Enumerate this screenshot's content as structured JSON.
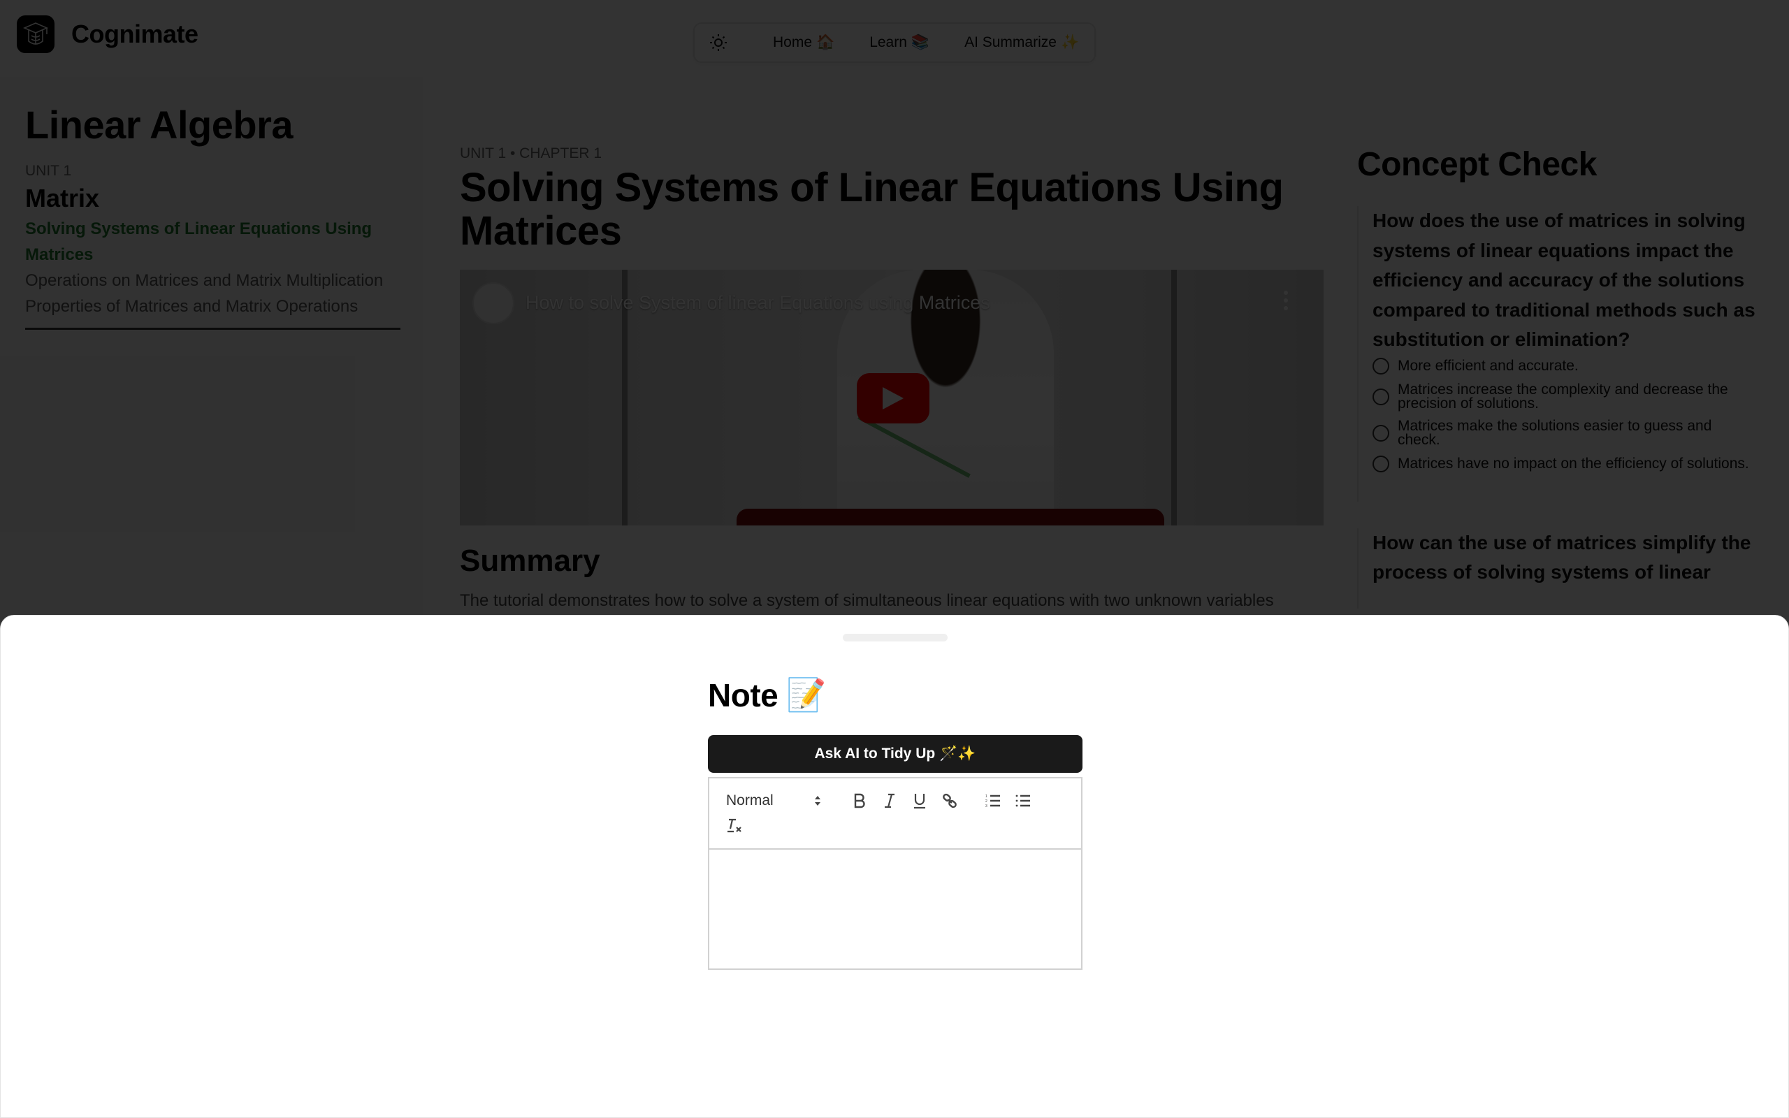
{
  "app": {
    "name": "Cognimate",
    "logo_icon": "graduation-cap-tree-icon"
  },
  "nav": {
    "theme_icon": "sun-icon",
    "items": [
      {
        "label": "Home",
        "emoji": "🏠"
      },
      {
        "label": "Learn",
        "emoji": "📚"
      },
      {
        "label": "AI Summarize",
        "emoji": "✨"
      }
    ]
  },
  "sidebar": {
    "course_title": "Linear Algebra",
    "unit_label": "UNIT 1",
    "unit_title": "Matrix",
    "chapters": [
      {
        "label": "Solving Systems of Linear Equations Using Matrices",
        "active": true
      },
      {
        "label": "Operations on Matrices and Matrix Multiplication",
        "active": false
      },
      {
        "label": "Properties of Matrices and Matrix Operations",
        "active": false
      }
    ],
    "active_color": "#1f7a2e"
  },
  "main": {
    "breadcrumb": "UNIT 1 • CHAPTER 1",
    "title": "Solving Systems of Linear Equations Using Matrices",
    "video": {
      "title": "How to solve System of linear Equations using Matrices",
      "play_icon": "youtube-play-icon",
      "menu_icon": "more-vertical-icon"
    },
    "summary_title": "Summary",
    "summary_text": "The tutorial demonstrates how to solve a system of simultaneous linear equations with two unknown variables"
  },
  "concept_check": {
    "title": "Concept Check",
    "questions": [
      {
        "question": "How does the use of matrices in solving systems of linear equations impact the efficiency and accuracy of the solutions compared to traditional methods such as substitution or elimination?",
        "options": [
          "More efficient and accurate.",
          "Matrices increase the complexity and decrease the precision of solutions.",
          "Matrices make the solutions easier to guess and check.",
          "Matrices have no impact on the efficiency of solutions."
        ]
      },
      {
        "question": "How can the use of matrices simplify the process of solving systems of linear",
        "options": []
      }
    ]
  },
  "note_drawer": {
    "title": "Note",
    "title_emoji": "📝",
    "tidy_button": "Ask AI to Tidy Up",
    "tidy_emoji": "🪄✨",
    "toolbar": {
      "format_select": "Normal",
      "buttons": [
        "bold-icon",
        "italic-icon",
        "underline-icon",
        "link-icon",
        "ordered-list-icon",
        "bullet-list-icon",
        "clear-format-icon"
      ]
    },
    "editor_content": ""
  }
}
